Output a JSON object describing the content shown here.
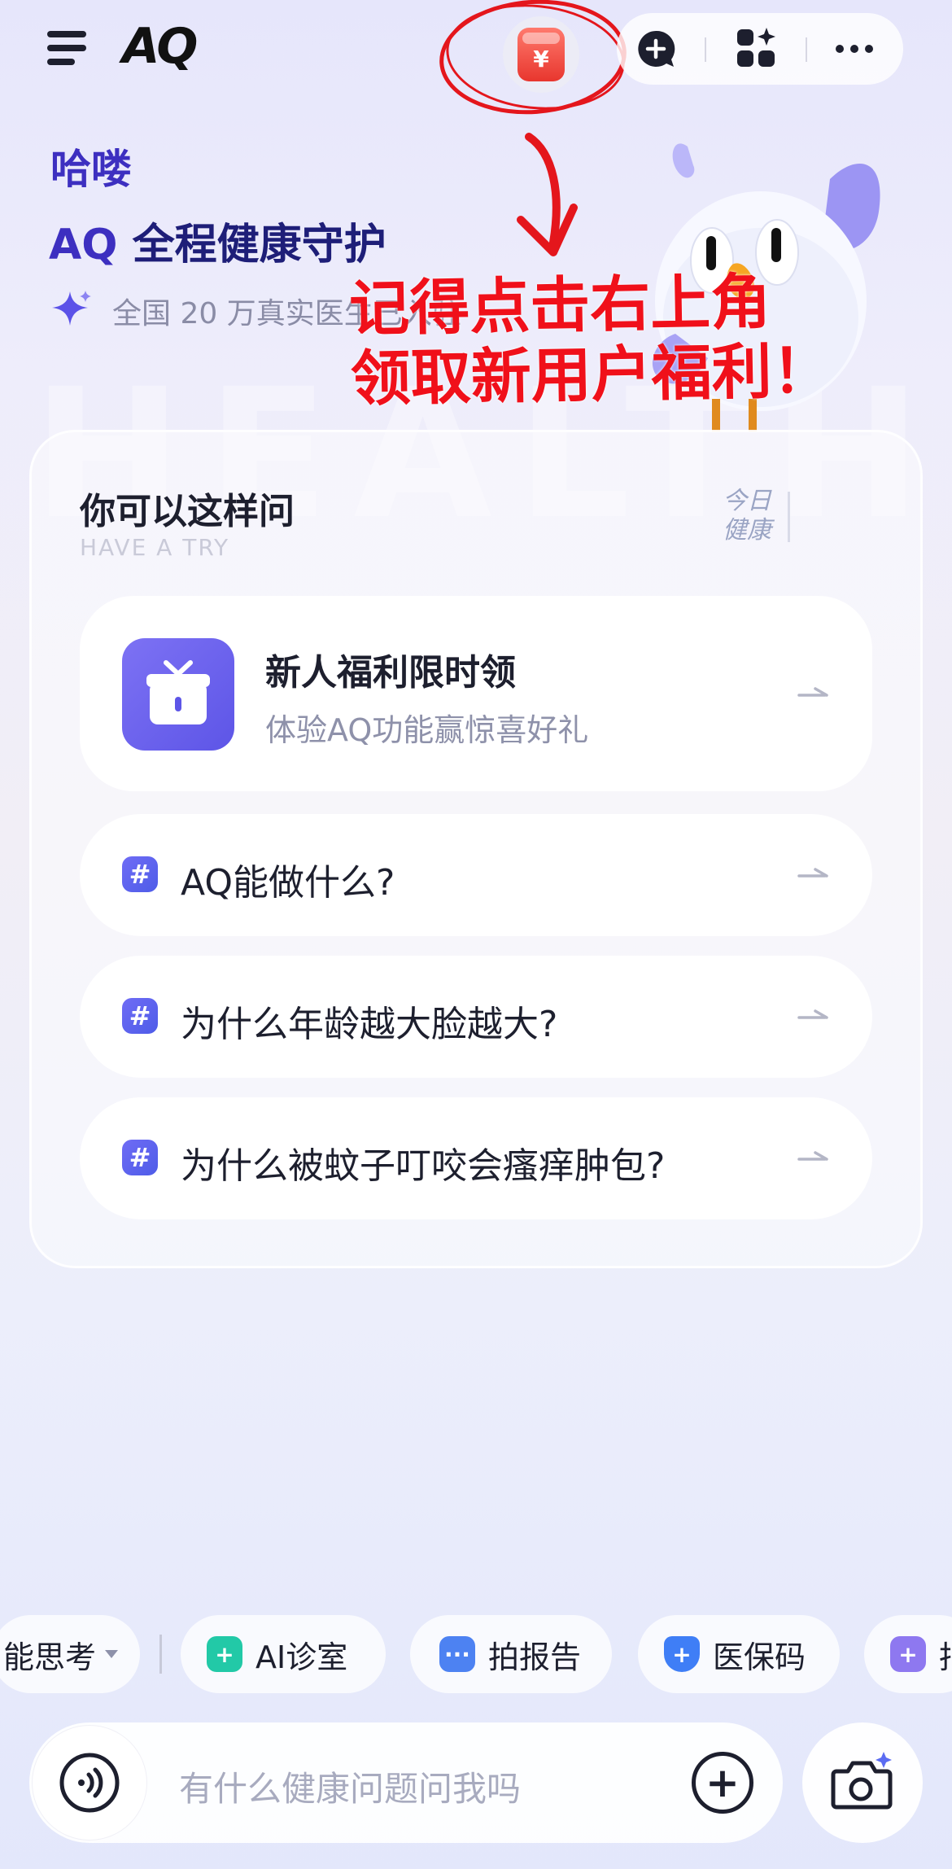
{
  "header": {
    "logo": "AQ",
    "coin_symbol": "¥"
  },
  "greeting": {
    "line1": "哈喽",
    "line2_brand": "AQ",
    "line2_rest": "全程健康守护",
    "line3": "全国 20 万真实医生已入驻"
  },
  "watermark": "HEALTH",
  "annotation": {
    "line1": "记得点击右上角",
    "line2": "领取新用户福利！"
  },
  "card": {
    "title": "你可以这样问",
    "subtitle": "HAVE A TRY",
    "today_line1": "今日",
    "today_line2": "健康",
    "welfare": {
      "title": "新人福利限时领",
      "subtitle": "体验AQ功能赢惊喜好礼"
    },
    "questions": [
      {
        "hash": "#",
        "text": "AQ能做什么?"
      },
      {
        "hash": "#",
        "text": "为什么年龄越大脸越大?"
      },
      {
        "hash": "#",
        "text": "为什么被蚊子叮咬会瘙痒肿包?"
      }
    ]
  },
  "chips": [
    {
      "label": "能思考",
      "icon": "caret-down-icon"
    },
    {
      "label": "AI诊室",
      "icon": "plus-icon",
      "color": "#22c9a7"
    },
    {
      "label": "拍报告",
      "icon": "document-icon",
      "color": "#4d82f2"
    },
    {
      "label": "医保码",
      "icon": "shield-icon",
      "color": "#3f7ef6"
    },
    {
      "label": "拍",
      "icon": "medicine-icon",
      "color": "#8e78f0"
    }
  ],
  "input": {
    "placeholder": "有什么健康问题问我吗",
    "plus": "+"
  },
  "colors": {
    "brand": "#3d2fc0",
    "annotation": "#f0101a",
    "accent": "#5d55e7"
  }
}
